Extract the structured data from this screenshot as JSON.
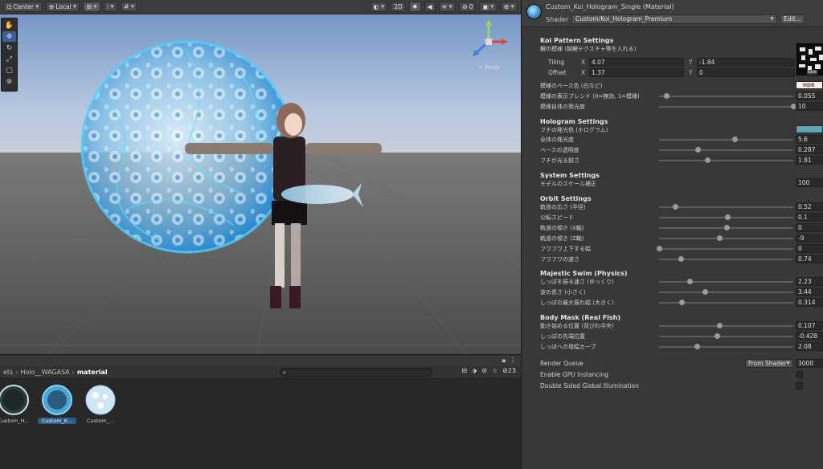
{
  "toolbar": {
    "pivot": "Center",
    "space": "Local",
    "view2d": "2D"
  },
  "scene": {
    "projection": "< Persp"
  },
  "project": {
    "count": "23",
    "breadcrumb": [
      "ets",
      "Holo__WAGASA",
      "material"
    ],
    "assets": [
      {
        "label": "Custom_H..."
      },
      {
        "label": "Custom_K..."
      },
      {
        "label": "Custom_..."
      }
    ]
  },
  "inspector": {
    "title": "Custom_Koi_Hologram_Single (Material)",
    "shader_label": "Shader",
    "shader_value": "Custom/Koi_Hologram_Premium",
    "edit_label": "Edit...",
    "koi": {
      "title": "Koi Pattern Settings",
      "sub": "鯉の模様 (錦鯉テクスチャ等を入れる)",
      "tiling_label": "Tiling",
      "offset_label": "Offset",
      "tiling_x": "4.07",
      "tiling_y": "-1.84",
      "offset_x": "1.37",
      "offset_y": "0",
      "tex_select": "Sele",
      "base_color_label": "模様のベース色 (白など)",
      "blend_label": "模様の表示ブレンド (0=無効, 1=模様)",
      "blend_value": "0.055",
      "emission_label": "模様自体の発光度",
      "emission_value": "10",
      "hdr": "HDR"
    },
    "holo": {
      "title": "Hologram Settings",
      "sub": "フチの発光色 (ホログラム)",
      "glow_label": "全体の発光度",
      "glow_value": "5.6",
      "alpha_label": "ベースの透明度",
      "alpha_value": "0.287",
      "rim_label": "フチが光る鋭さ",
      "rim_value": "1.81"
    },
    "system": {
      "title": "System Settings",
      "scale_label": "モデルのスケール補正",
      "scale_value": "100"
    },
    "orbit": {
      "title": "Orbit Settings",
      "radius_label": "軌道の広さ (半径)",
      "radius_value": "0.52",
      "speed_label": "公転スピード",
      "speed_value": "0.1",
      "tiltx_label": "軌道の傾き (X軸)",
      "tiltx_value": "0",
      "tiltz_label": "軌道の傾き (Z軸)",
      "tiltz_value": "-9",
      "bob_label": "フワフワ上下する幅",
      "bob_value": "0",
      "bobspeed_label": "フワフワの速さ",
      "bobspeed_value": "0.74"
    },
    "swim": {
      "title": "Majestic Swim (Physics)",
      "tailspeed_label": "しっぽを振る速さ (ゆっくり)",
      "tailspeed_value": "2.23",
      "wave_label": "波の長さ (小さく)",
      "wave_value": "3.44",
      "amp_label": "しっぽの最大振れ幅 (大きく)",
      "amp_value": "0.314"
    },
    "mask": {
      "title": "Body Mask (Real Fish)",
      "start_label": "動き始める位置 (背びれ中央)",
      "start_value": "0.107",
      "tip_label": "しっぽの先端位置",
      "tip_value": "-0.428",
      "curve_label": "しっぽへの増幅カーブ",
      "curve_value": "2.08"
    },
    "render": {
      "queue_label": "Render Queue",
      "queue_mode": "From Shader",
      "queue_value": "3000",
      "gpu_label": "Enable GPU Instancing",
      "gi_label": "Double Sided Global Illumination"
    },
    "slider_positions": {
      "blend": 0.055,
      "emission": 1.0,
      "glow": 0.56,
      "alpha": 0.287,
      "rim": 0.36,
      "radius": 0.12,
      "speed": 0.51,
      "tiltx": 0.5,
      "tiltz": 0.45,
      "bob": 0.0,
      "bobspeed": 0.16,
      "tailspeed": 0.23,
      "wave": 0.34,
      "amp": 0.17,
      "start": 0.45,
      "tip": 0.43,
      "curve": 0.28
    }
  }
}
